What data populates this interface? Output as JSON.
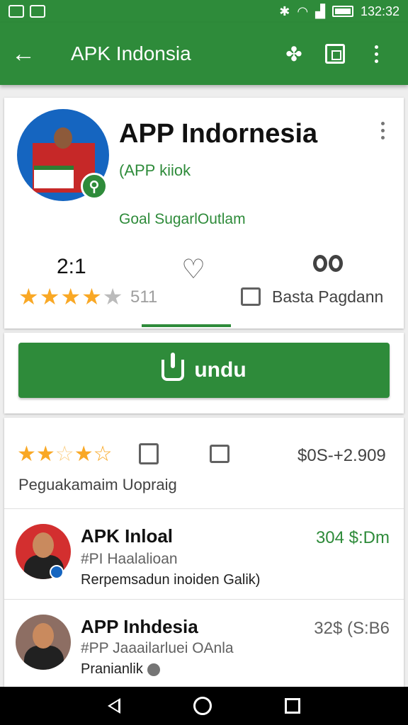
{
  "status_bar": {
    "time": "132:32",
    "icons": [
      "notification-icon",
      "image-icon",
      "bluetooth-icon",
      "wifi-icon",
      "signal-icon",
      "battery-icon"
    ]
  },
  "app_bar": {
    "title": "APK Indonsia",
    "color": "#2e8b3a",
    "actions": [
      "back-arrow-icon",
      "puzzle-icon",
      "square-icon",
      "more-vert-icon"
    ]
  },
  "app_card": {
    "name": "APP Indornesia",
    "subtitle": "(APP kiiok",
    "developer": "Goal SugarlOutlam",
    "rating": "2:1",
    "stars": "★★★★",
    "half_star": "★",
    "rating_count": "511",
    "category": "Basta Pagdann"
  },
  "install": {
    "label": "undu"
  },
  "reviews": {
    "stars_full": "★★",
    "stars_empty": "☆",
    "stars_rest": "★☆",
    "price": "$0S-+2.909",
    "label": "Peguakamaim Uopraig"
  },
  "list": [
    {
      "title": "APK Inloal",
      "subtitle": "#PI Haalalioan",
      "description": "Rerpemsadun inoiden Galik)",
      "price": "304 $:Dm"
    },
    {
      "title": "APP Inhdesia",
      "subtitle": "#PP Jaaailarluei OAnla",
      "description": "Pranianlik",
      "price": "32$ (S:B6"
    }
  ],
  "accent_color": "#2e8b3a",
  "star_color": "#f9a825"
}
